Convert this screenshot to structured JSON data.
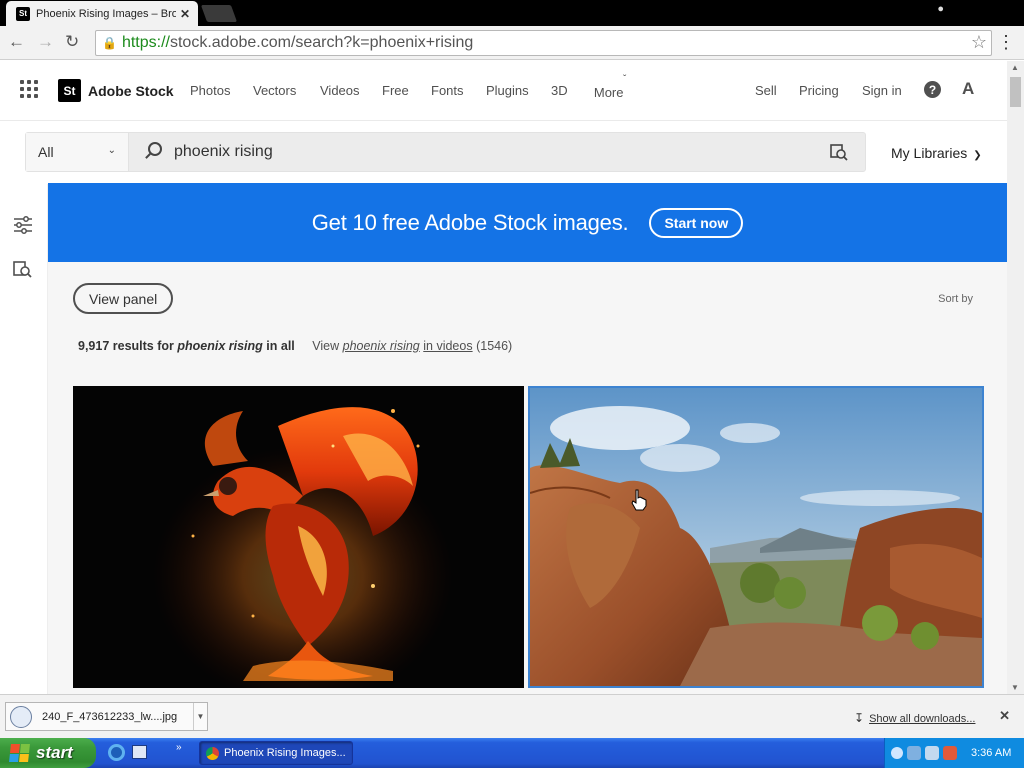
{
  "browser": {
    "tab_title": "Phoenix Rising Images – Bro",
    "tab_favicon": "St",
    "tab_close": "✕",
    "url_scheme": "https://",
    "url_rest": "stock.adobe.com/search?k=phoenix+rising"
  },
  "site": {
    "brand_logo": "St",
    "brand_name": "Adobe Stock",
    "nav": [
      "Photos",
      "Vectors",
      "Videos",
      "Free",
      "Fonts",
      "Plugins",
      "3D"
    ],
    "more": "More",
    "right_nav": [
      "Sell",
      "Pricing",
      "Sign in"
    ],
    "help": "?",
    "adobe_glyph": "A"
  },
  "search": {
    "filter": "All",
    "query": "phoenix rising",
    "my_libraries": "My Libraries"
  },
  "banner": {
    "text": "Get 10 free Adobe Stock images.",
    "button": "Start now",
    "color": "#1473e6"
  },
  "results": {
    "view_panel": "View panel",
    "sort_by": "Sort by",
    "count": "9,917 results for",
    "query": "phoenix rising",
    "scope": "in all",
    "videos_prefix": "View",
    "videos_query": "phoenix rising",
    "videos_suffix": "in videos",
    "videos_count": "(1546)"
  },
  "thumbnails": [
    {
      "subject": "fiery-phoenix"
    },
    {
      "subject": "desert-rocks-landscape",
      "selected": true,
      "highlight_color": "#3d83d1"
    }
  ],
  "downloads": {
    "file_name": "240_F_473612233_lw....jpg",
    "show_all": "Show all downloads...",
    "close": "✕"
  },
  "taskbar": {
    "start": "start",
    "task_label": "Phoenix Rising Images...",
    "clock": "3:36 AM",
    "ql_more": "»"
  }
}
